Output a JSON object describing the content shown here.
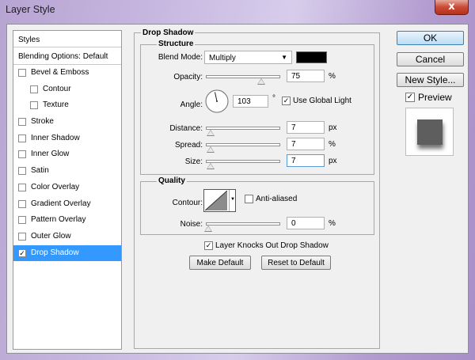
{
  "window": {
    "title": "Layer Style",
    "close_glyph": "x"
  },
  "styles_panel": {
    "header": "Styles",
    "blending": "Blending Options: Default",
    "items": [
      {
        "label": "Bevel & Emboss",
        "checked": false,
        "indent": false
      },
      {
        "label": "Contour",
        "checked": false,
        "indent": true
      },
      {
        "label": "Texture",
        "checked": false,
        "indent": true
      },
      {
        "label": "Stroke",
        "checked": false,
        "indent": false
      },
      {
        "label": "Inner Shadow",
        "checked": false,
        "indent": false
      },
      {
        "label": "Inner Glow",
        "checked": false,
        "indent": false
      },
      {
        "label": "Satin",
        "checked": false,
        "indent": false
      },
      {
        "label": "Color Overlay",
        "checked": false,
        "indent": false
      },
      {
        "label": "Gradient Overlay",
        "checked": false,
        "indent": false
      },
      {
        "label": "Pattern Overlay",
        "checked": false,
        "indent": false
      },
      {
        "label": "Outer Glow",
        "checked": false,
        "indent": false
      },
      {
        "label": "Drop Shadow",
        "checked": true,
        "indent": false,
        "selected": true
      }
    ]
  },
  "drop_shadow": {
    "group_title": "Drop Shadow",
    "structure": {
      "title": "Structure",
      "blend_mode_label": "Blend Mode:",
      "blend_mode_value": "Multiply",
      "shadow_color": "#000000",
      "opacity_label": "Opacity:",
      "opacity_value": "75",
      "opacity_unit": "%",
      "angle_label": "Angle:",
      "angle_value": "103",
      "angle_unit": "°",
      "use_global_light_label": "Use Global Light",
      "use_global_light": true,
      "distance_label": "Distance:",
      "distance_value": "7",
      "distance_unit": "px",
      "spread_label": "Spread:",
      "spread_value": "7",
      "spread_unit": "%",
      "size_label": "Size:",
      "size_value": "7",
      "size_unit": "px"
    },
    "quality": {
      "title": "Quality",
      "contour_label": "Contour:",
      "anti_aliased_label": "Anti-aliased",
      "anti_aliased": false,
      "noise_label": "Noise:",
      "noise_value": "0",
      "noise_unit": "%"
    },
    "knockout_label": "Layer Knocks Out Drop Shadow",
    "knockout": true,
    "make_default_label": "Make Default",
    "reset_default_label": "Reset to Default"
  },
  "buttons": {
    "ok": "OK",
    "cancel": "Cancel",
    "new_style": "New Style...",
    "preview_label": "Preview",
    "preview_checked": true
  },
  "check_glyph": "✓",
  "dropdown_glyph": "▼"
}
